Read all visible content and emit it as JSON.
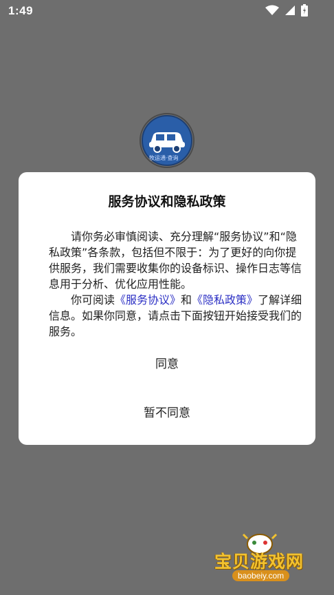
{
  "status_bar": {
    "time": "1:49",
    "icons": [
      "wifi-icon",
      "signal-icon",
      "battery-icon"
    ]
  },
  "app_logo": {
    "icon": "car-logo-icon",
    "text": "牧运通·查询"
  },
  "dialog": {
    "title": "服务协议和隐私政策",
    "paragraph1": "请你务必审慎阅读、充分理解“服务协议”和“隐私政策”各条款，包括但不限于：为了更好的向你提供服务，我们需要收集你的设备标识、操作日志等信息用于分析、优化应用性能。",
    "paragraph2_prefix": "你可阅读",
    "service_link": "《服务协议》",
    "and_text": "和",
    "privacy_link": "《隐私政策》",
    "paragraph2_suffix": "了解详细信息。如果你同意，请点击下面按钮开始接受我们的服务。",
    "agree_label": "同意",
    "disagree_label": "暂不同意"
  },
  "watermark": {
    "title": "宝贝游戏网",
    "url": "baobeiy.com",
    "icon": "gamepad-mascot-icon"
  },
  "colors": {
    "overlay": "#6e6e6e",
    "dialog_bg": "#ffffff",
    "link": "#2b2fc4",
    "logo_blue": "#2a5ea8"
  }
}
